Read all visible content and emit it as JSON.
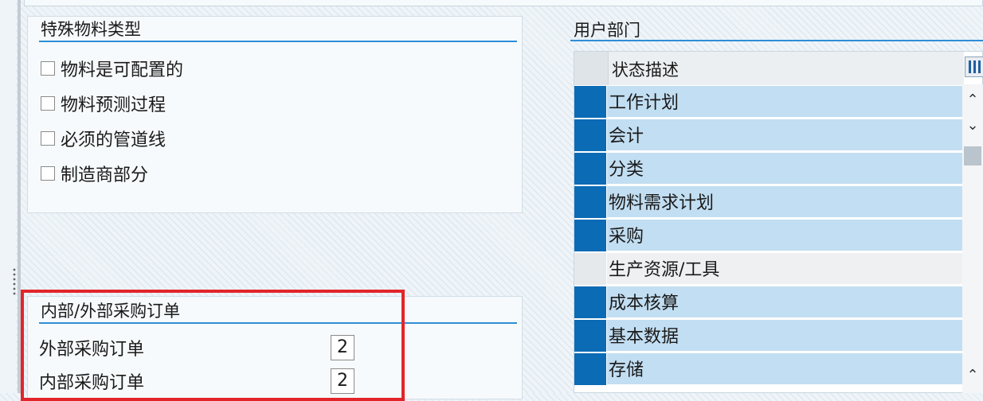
{
  "special_material_types": {
    "title": "特殊物料类型",
    "checkboxes": [
      {
        "label": "物料是可配置的",
        "checked": false
      },
      {
        "label": "物料预测过程",
        "checked": false
      },
      {
        "label": "必须的管道线",
        "checked": false
      },
      {
        "label": "制造商部分",
        "checked": false
      }
    ]
  },
  "purchase_orders": {
    "title": "内部/外部采购订单",
    "fields": [
      {
        "label": "外部采购订单",
        "value": "2"
      },
      {
        "label": "内部采购订单",
        "value": "2"
      }
    ]
  },
  "user_departments": {
    "title": "用户部门",
    "column_header": "状态描述",
    "rows": [
      {
        "label": "工作计划",
        "selected": true
      },
      {
        "label": "会计",
        "selected": true
      },
      {
        "label": "分类",
        "selected": true
      },
      {
        "label": "物料需求计划",
        "selected": true
      },
      {
        "label": "采购",
        "selected": true
      },
      {
        "label": "生产资源/工具",
        "selected": false
      },
      {
        "label": "成本核算",
        "selected": true
      },
      {
        "label": "基本数据",
        "selected": true
      },
      {
        "label": "存储",
        "selected": true
      }
    ]
  },
  "colors": {
    "accent_line": "#2d8ed6",
    "selected_marker": "#0b6bb5",
    "selected_row": "#c2def2",
    "highlight_box": "#e2252b"
  }
}
